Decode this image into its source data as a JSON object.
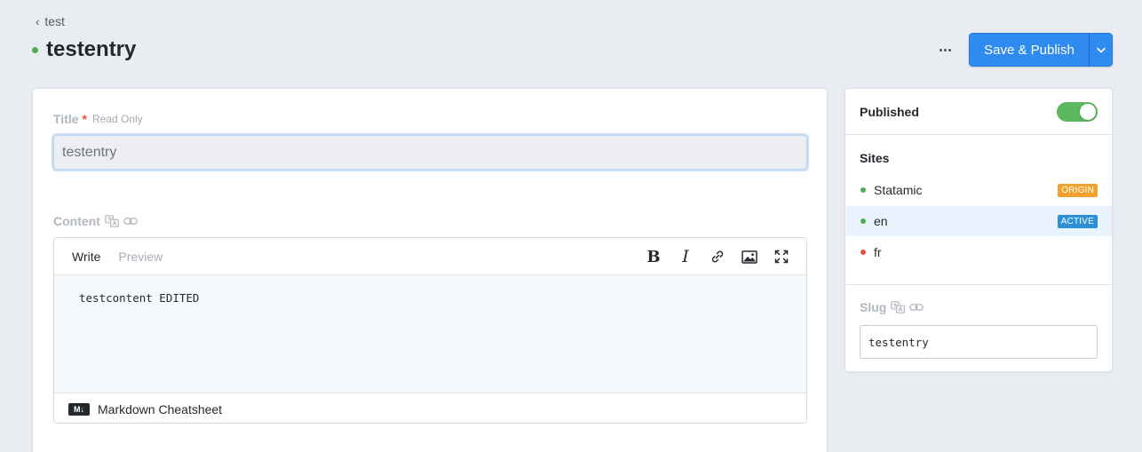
{
  "breadcrumb": {
    "label": "test"
  },
  "header": {
    "title": "testentry",
    "status_color": "#4caf50",
    "more_icon": "ellipsis-icon",
    "publish_label": "Save & Publish",
    "accent": "#2f8bf0"
  },
  "fields": {
    "title": {
      "label": "Title",
      "required": "*",
      "note": "Read Only",
      "value": "testentry"
    },
    "content": {
      "label": "Content",
      "tabs": [
        "Write",
        "Preview"
      ],
      "value": "testcontent EDITED",
      "tools": [
        "bold-icon",
        "italic-icon",
        "link-icon",
        "image-icon",
        "fullscreen-icon"
      ],
      "bold_glyph": "B",
      "italic_glyph": "I",
      "footer_icon": "M↓",
      "footer_label": "Markdown Cheatsheet"
    }
  },
  "sidebar": {
    "published_label": "Published",
    "published": true,
    "sites_heading": "Sites",
    "sites": [
      {
        "name": "Statamic",
        "dot": "#4caf50",
        "badge": "ORIGIN",
        "badge_color": "#f0a22e"
      },
      {
        "name": "en",
        "dot": "#4caf50",
        "badge": "ACTIVE",
        "badge_color": "#2d8fd5"
      },
      {
        "name": "fr",
        "dot": "#e74c3c",
        "badge": "",
        "badge_color": ""
      }
    ],
    "slug": {
      "label": "Slug",
      "value": "testentry"
    }
  }
}
